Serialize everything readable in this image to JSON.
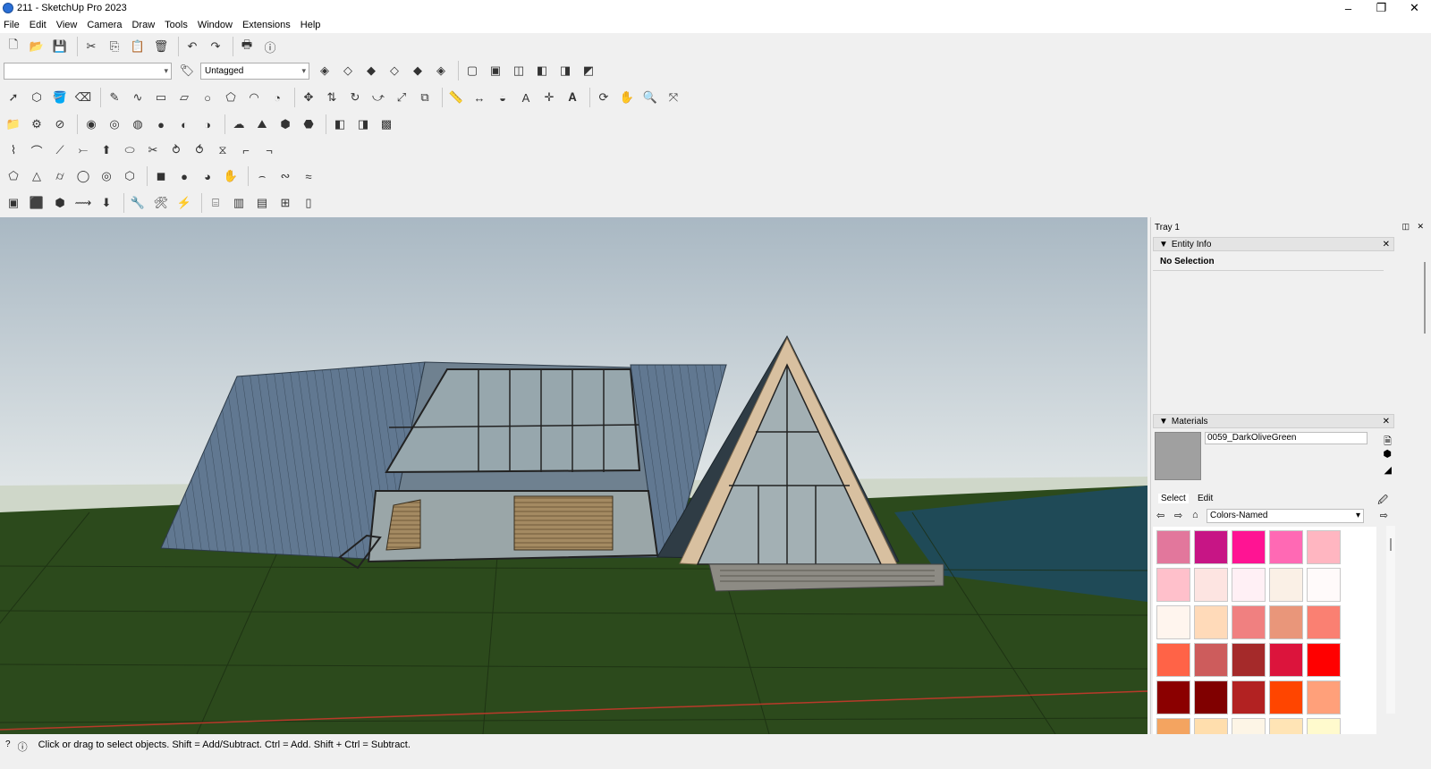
{
  "app": {
    "title": "211 - SketchUp Pro 2023",
    "window_controls": {
      "minimize": "–",
      "maximize": "❐",
      "close": "✕"
    }
  },
  "menu": [
    "File",
    "Edit",
    "View",
    "Camera",
    "Draw",
    "Tools",
    "Window",
    "Extensions",
    "Help"
  ],
  "toolbar": {
    "tag_dropdown": "Untagged",
    "layer_input": ""
  },
  "tray": {
    "title": "Tray 1",
    "entity_info": {
      "title": "Entity Info",
      "value": "No Selection"
    },
    "materials": {
      "title": "Materials",
      "material_name": "0059_DarkOliveGreen",
      "tabs": [
        "Select",
        "Edit"
      ],
      "library": "Colors-Named",
      "swatch_colors": [
        "#e2779c",
        "#c71585",
        "#ff1493",
        "#ff69b4",
        "#ffb6c1",
        "#ffc0cb",
        "#fde4e1",
        "#fff0f5",
        "#faf0e6",
        "#fffafa",
        "#fff5ee",
        "#ffdab9",
        "#f08080",
        "#e9967a",
        "#fa8072",
        "#ff6347",
        "#cd5c5c",
        "#a52a2a",
        "#dc143c",
        "#ff0000",
        "#8b0000",
        "#800000",
        "#b22222",
        "#ff4500",
        "#ffa07a",
        "#f4a460",
        "#ffdead",
        "#fdf5e6",
        "#ffe4b5",
        "#fffacd"
      ]
    }
  },
  "status": {
    "text": "Click or drag to select objects. Shift = Add/Subtract. Ctrl = Add. Shift + Ctrl = Subtract."
  },
  "colors": {
    "sky_top": "#a9b8c3",
    "sky_bottom": "#e3e8e9",
    "ground": "#2c4a1c",
    "roof": "#5f7488",
    "accent": "#2a6fd6"
  },
  "icons": [
    "app-icon",
    "new-icon",
    "open-icon",
    "save-icon",
    "cut-icon",
    "copy-icon",
    "paste-icon",
    "erase-icon",
    "undo-icon",
    "redo-icon",
    "print-icon",
    "info-icon",
    "select-icon",
    "pencil-icon",
    "paint-bucket-icon",
    "back-icon",
    "forward-icon",
    "home-icon",
    "eyedropper-icon"
  ]
}
